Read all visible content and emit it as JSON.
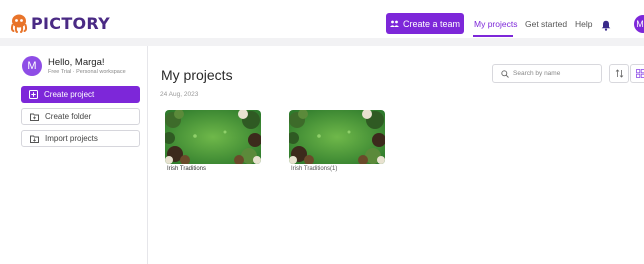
{
  "brand": {
    "name": "PICTORY",
    "logo_color": "#4a2a84",
    "accent": "#7d27d9"
  },
  "header": {
    "create_team_label": "Create a team",
    "nav": [
      {
        "label": "My projects",
        "active": true
      },
      {
        "label": "Get started",
        "active": false
      },
      {
        "label": "Help",
        "active": false
      }
    ],
    "icons": {
      "team": "people-icon",
      "bell": "bell-icon"
    }
  },
  "sidebar": {
    "user": {
      "initial": "M",
      "greeting": "Hello, Marga!",
      "plan": "Free Trial · Personal workspace"
    },
    "buttons": [
      {
        "label": "Create project",
        "icon": "plus-square-icon",
        "primary": true
      },
      {
        "label": "Create folder",
        "icon": "folder-plus-icon",
        "primary": false
      },
      {
        "label": "Import projects",
        "icon": "import-icon",
        "primary": false
      }
    ]
  },
  "main": {
    "title": "My projects",
    "date_group": "24 Aug, 2023",
    "search": {
      "placeholder": "Search by name",
      "icon": "search-icon"
    },
    "toolbar_icons": [
      "sort-icon",
      "grid-view-icon"
    ],
    "projects": [
      {
        "title": "Irish Traditions",
        "thumbnail": "shamrock-thumbnail"
      },
      {
        "title": "Irish Traditions(1)",
        "thumbnail": "shamrock-thumbnail"
      }
    ]
  }
}
